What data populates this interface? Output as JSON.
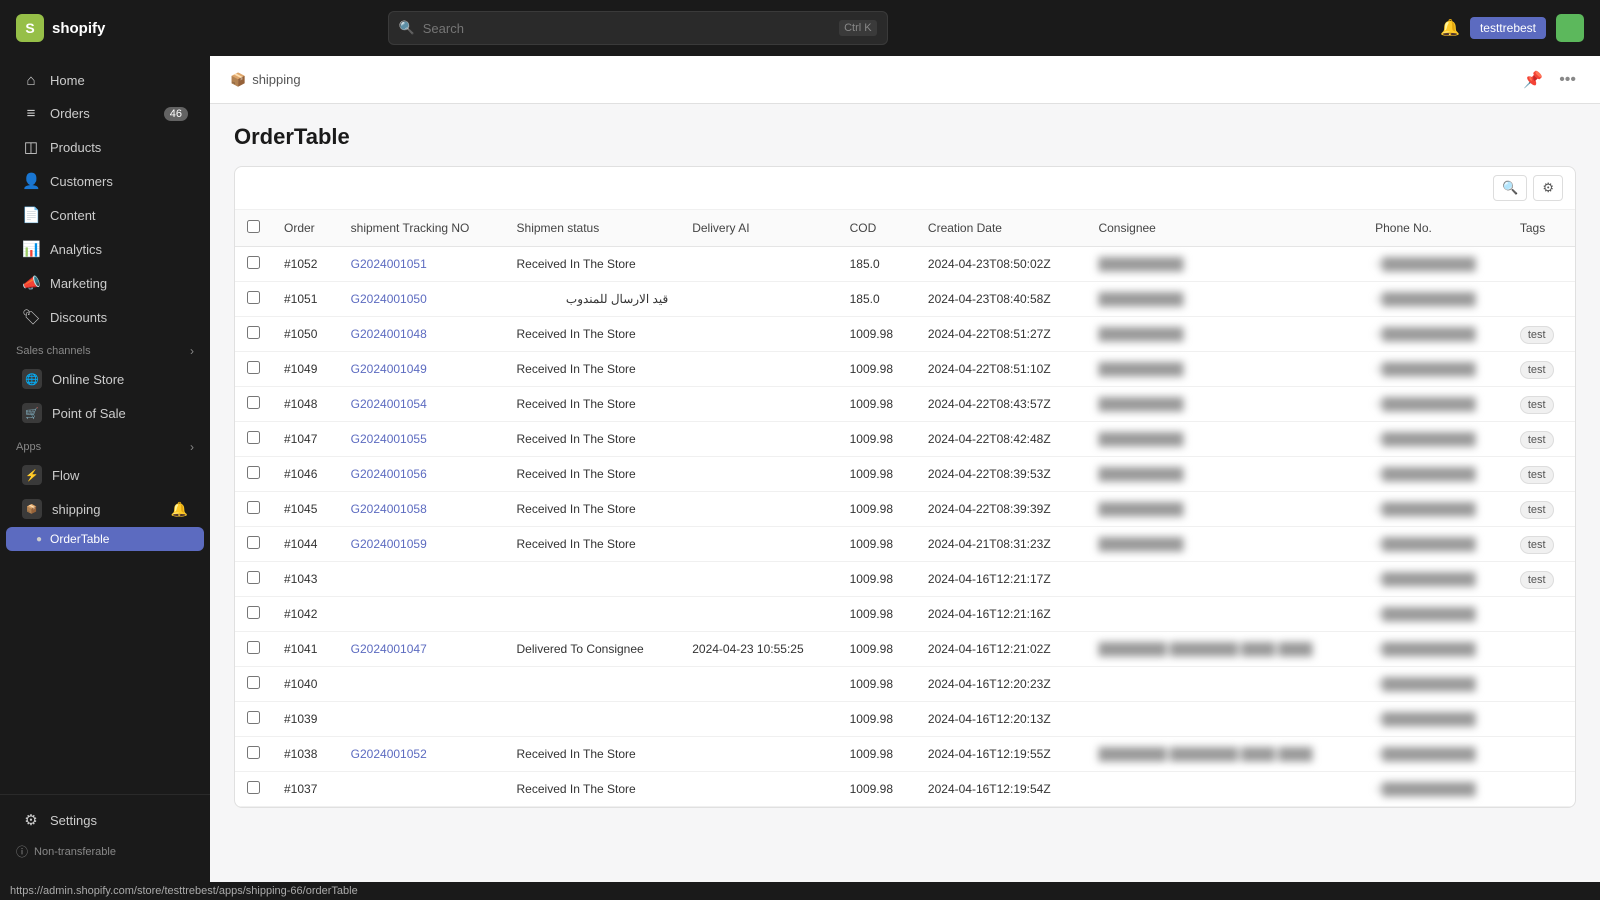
{
  "topbar": {
    "logo_text": "shopify",
    "search_placeholder": "Search",
    "search_shortcut": "Ctrl K",
    "username": "testtrebest"
  },
  "sidebar": {
    "nav_items": [
      {
        "id": "home",
        "label": "Home",
        "icon": "⌂",
        "badge": null
      },
      {
        "id": "orders",
        "label": "Orders",
        "icon": "≡",
        "badge": "46"
      },
      {
        "id": "products",
        "label": "Products",
        "icon": "◫",
        "badge": null
      },
      {
        "id": "customers",
        "label": "Customers",
        "icon": "👤",
        "badge": null
      },
      {
        "id": "content",
        "label": "Content",
        "icon": "📄",
        "badge": null
      },
      {
        "id": "analytics",
        "label": "Analytics",
        "icon": "📊",
        "badge": null
      },
      {
        "id": "marketing",
        "label": "Marketing",
        "icon": "📣",
        "badge": null
      },
      {
        "id": "discounts",
        "label": "Discounts",
        "icon": "🏷",
        "badge": null
      }
    ],
    "sales_channels_label": "Sales channels",
    "sales_channels": [
      {
        "id": "online-store",
        "label": "Online Store",
        "icon": "🌐"
      },
      {
        "id": "point-of-sale",
        "label": "Point of Sale",
        "icon": "🛒"
      }
    ],
    "apps_label": "Apps",
    "apps": [
      {
        "id": "flow",
        "label": "Flow",
        "icon": "⚡"
      },
      {
        "id": "shipping",
        "label": "shipping",
        "icon": "📦",
        "has_bell": true
      }
    ],
    "sub_items": [
      {
        "id": "order-table",
        "label": "OrderTable",
        "active": true
      }
    ],
    "settings_label": "Settings",
    "non_transferable_label": "Non-transferable"
  },
  "page": {
    "breadcrumb_icon": "📦",
    "breadcrumb_text": "shipping",
    "title": "OrderTable",
    "table": {
      "columns": [
        "Order",
        "shipment Tracking NO",
        "Shipmen status",
        "Delivery AI",
        "COD",
        "Creation Date",
        "Consignee",
        "Phone No.",
        "Tags"
      ],
      "rows": [
        {
          "order": "#1052",
          "tracking": "G2024001051",
          "status": "Received In The Store",
          "delivery_ai": "",
          "cod": "185.0",
          "creation_date": "2024-04-23T08:50:02Z",
          "consignee": "REDACTED",
          "phone": "REDACTED",
          "tags": ""
        },
        {
          "order": "#1051",
          "tracking": "G2024001050",
          "status": "قيد الارسال للمندوب",
          "delivery_ai": "",
          "cod": "185.0",
          "creation_date": "2024-04-23T08:40:58Z",
          "consignee": "REDACTED",
          "phone": "REDACTED",
          "tags": ""
        },
        {
          "order": "#1050",
          "tracking": "G2024001048",
          "status": "Received In The Store",
          "delivery_ai": "",
          "cod": "1009.98",
          "creation_date": "2024-04-22T08:51:27Z",
          "consignee": "REDACTED",
          "phone": "REDACTED",
          "tags": "test"
        },
        {
          "order": "#1049",
          "tracking": "G2024001049",
          "status": "Received In The Store",
          "delivery_ai": "",
          "cod": "1009.98",
          "creation_date": "2024-04-22T08:51:10Z",
          "consignee": "REDACTED",
          "phone": "REDACTED",
          "tags": "test"
        },
        {
          "order": "#1048",
          "tracking": "G2024001054",
          "status": "Received In The Store",
          "delivery_ai": "",
          "cod": "1009.98",
          "creation_date": "2024-04-22T08:43:57Z",
          "consignee": "REDACTED",
          "phone": "REDACTED",
          "tags": "test"
        },
        {
          "order": "#1047",
          "tracking": "G2024001055",
          "status": "Received In The Store",
          "delivery_ai": "",
          "cod": "1009.98",
          "creation_date": "2024-04-22T08:42:48Z",
          "consignee": "REDACTED",
          "phone": "REDACTED",
          "tags": "test"
        },
        {
          "order": "#1046",
          "tracking": "G2024001056",
          "status": "Received In The Store",
          "delivery_ai": "",
          "cod": "1009.98",
          "creation_date": "2024-04-22T08:39:53Z",
          "consignee": "REDACTED",
          "phone": "REDACTED",
          "tags": "test"
        },
        {
          "order": "#1045",
          "tracking": "G2024001058",
          "status": "Received In The Store",
          "delivery_ai": "",
          "cod": "1009.98",
          "creation_date": "2024-04-22T08:39:39Z",
          "consignee": "REDACTED",
          "phone": "REDACTED",
          "tags": "test"
        },
        {
          "order": "#1044",
          "tracking": "G2024001059",
          "status": "Received In The Store",
          "delivery_ai": "",
          "cod": "1009.98",
          "creation_date": "2024-04-21T08:31:23Z",
          "consignee": "REDACTED",
          "phone": "REDACTED",
          "tags": "test"
        },
        {
          "order": "#1043",
          "tracking": "",
          "status": "",
          "delivery_ai": "",
          "cod": "1009.98",
          "creation_date": "2024-04-16T12:21:17Z",
          "consignee": "",
          "phone": "REDACTED",
          "tags": "test"
        },
        {
          "order": "#1042",
          "tracking": "",
          "status": "",
          "delivery_ai": "",
          "cod": "1009.98",
          "creation_date": "2024-04-16T12:21:16Z",
          "consignee": "",
          "phone": "REDACTED",
          "tags": ""
        },
        {
          "order": "#1041",
          "tracking": "G2024001047",
          "status": "Delivered To Consignee",
          "delivery_ai": "2024-04-23 10:55:25",
          "cod": "1009.98",
          "creation_date": "2024-04-16T12:21:02Z",
          "consignee": "REDACTED_LONG",
          "phone": "REDACTED",
          "tags": ""
        },
        {
          "order": "#1040",
          "tracking": "",
          "status": "",
          "delivery_ai": "",
          "cod": "1009.98",
          "creation_date": "2024-04-16T12:20:23Z",
          "consignee": "",
          "phone": "REDACTED",
          "tags": ""
        },
        {
          "order": "#1039",
          "tracking": "",
          "status": "",
          "delivery_ai": "",
          "cod": "1009.98",
          "creation_date": "2024-04-16T12:20:13Z",
          "consignee": "",
          "phone": "REDACTED",
          "tags": ""
        },
        {
          "order": "#1038",
          "tracking": "G2024001052",
          "status": "Received In The Store",
          "delivery_ai": "",
          "cod": "1009.98",
          "creation_date": "2024-04-16T12:19:55Z",
          "consignee": "REDACTED_LONG",
          "phone": "REDACTED",
          "tags": ""
        },
        {
          "order": "#1037",
          "tracking": "",
          "status": "Received In The Store",
          "delivery_ai": "",
          "cod": "1009.98",
          "creation_date": "2024-04-16T12:19:54Z",
          "consignee": "",
          "phone": "REDACTED",
          "tags": ""
        }
      ]
    }
  },
  "statusbar": {
    "url": "https://admin.shopify.com/store/testtrebest/apps/shipping-66/orderTable"
  }
}
